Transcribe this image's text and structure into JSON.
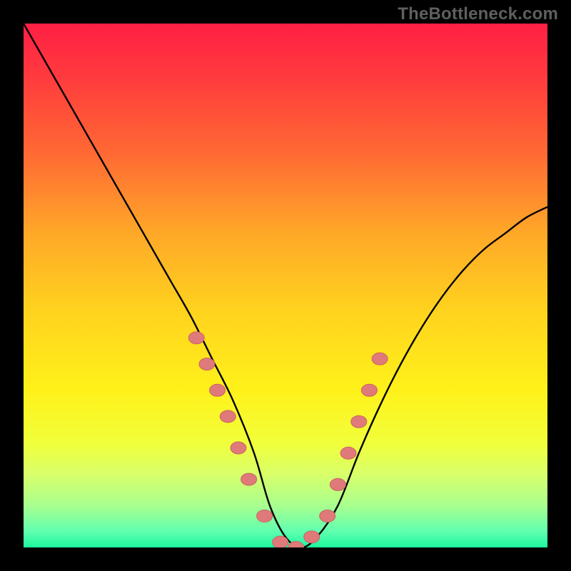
{
  "watermark": "TheBottleneck.com",
  "colors": {
    "frame": "#000000",
    "gradient_stops": [
      {
        "offset": 0.0,
        "color": "#ff1f44"
      },
      {
        "offset": 0.1,
        "color": "#ff3a3e"
      },
      {
        "offset": 0.25,
        "color": "#ff6a33"
      },
      {
        "offset": 0.4,
        "color": "#ffa828"
      },
      {
        "offset": 0.55,
        "color": "#ffd31e"
      },
      {
        "offset": 0.7,
        "color": "#fff11a"
      },
      {
        "offset": 0.8,
        "color": "#f1ff3a"
      },
      {
        "offset": 0.86,
        "color": "#d9ff6a"
      },
      {
        "offset": 0.92,
        "color": "#a8ff8e"
      },
      {
        "offset": 0.97,
        "color": "#5fffb0"
      },
      {
        "offset": 1.0,
        "color": "#1cf79c"
      }
    ],
    "curve": "#000000",
    "marker_fill": "#e07a7a",
    "marker_stroke": "#c96363"
  },
  "chart_data": {
    "type": "line",
    "title": "",
    "xlabel": "",
    "ylabel": "",
    "xlim": [
      0,
      100
    ],
    "ylim": [
      0,
      100
    ],
    "series": [
      {
        "name": "bottleneck-curve",
        "x": [
          0,
          4,
          8,
          12,
          16,
          20,
          24,
          28,
          32,
          36,
          40,
          44,
          47,
          50,
          53,
          56,
          60,
          64,
          68,
          72,
          76,
          80,
          84,
          88,
          92,
          96,
          100
        ],
        "y": [
          100,
          93,
          86,
          79,
          72,
          65,
          58,
          51,
          44,
          36,
          28,
          18,
          8,
          2,
          0,
          2,
          8,
          18,
          27,
          35,
          42,
          48,
          53,
          57,
          60,
          63,
          65
        ]
      }
    ],
    "markers": {
      "name": "highlighted-points",
      "x": [
        33,
        35,
        37,
        39,
        41,
        43,
        46,
        49,
        52,
        55,
        58,
        60,
        62,
        64,
        66,
        68
      ],
      "y": [
        40,
        35,
        30,
        25,
        19,
        13,
        6,
        1,
        0,
        2,
        6,
        12,
        18,
        24,
        30,
        36
      ]
    }
  }
}
